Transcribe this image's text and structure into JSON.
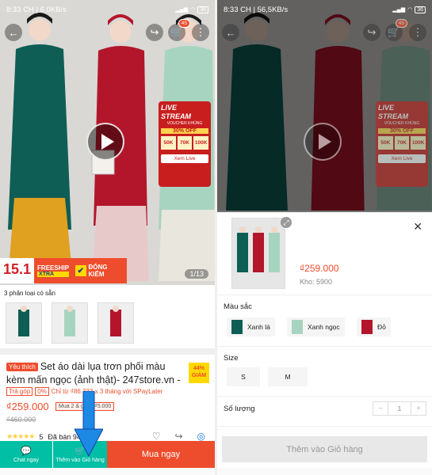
{
  "left": {
    "status": {
      "time": "8:33 CH | 6,0KB/s",
      "battery": "36"
    },
    "cart_badge": "45",
    "live": {
      "title": "LIVE STREAM",
      "subtitle": "VOUCHER KHỦNG",
      "off": "30% OFF",
      "vouchers": [
        "50K",
        "70K",
        "100K"
      ],
      "cta": "Xem Live"
    },
    "banner": {
      "date": "15.1",
      "freeship": "FREESHIP",
      "xtra": "XTRA",
      "dk": "ĐÓNG KIỂM"
    },
    "image_counter": "1/13",
    "variants_label": "3 phân loại có sẵn",
    "product": {
      "tag": "Yêu thích",
      "title": "Set áo dài lụa trơn phối màu kèm mấn ngọc (ảnh thật)- 247store.vn -",
      "discount": "44%",
      "discount_label": "GIẢM",
      "installment_label": "Trả góp",
      "installment_rate": "0%",
      "installment_text": "Chỉ từ ₫86.333 x 3 tháng với SPayLater",
      "price": "₫259.000",
      "buy2_text": "Mua 2 & giảm ₫5.000",
      "old_price": "₫460.000",
      "stars": "★★★★★",
      "rating": "5",
      "sold": "Đã bán 94"
    },
    "actions": {
      "chat": "Chat ngay",
      "add_cart": "Thêm vào Giỏ hàng",
      "buy_now": "Mua ngay"
    }
  },
  "right": {
    "status": {
      "time": "8:33 CH | 56,5KB/s",
      "battery": "36"
    },
    "cart_badge": "45",
    "live": {
      "title": "LIVE STREAM",
      "subtitle": "VOUCHER KHỦNG",
      "off": "30% OFF",
      "vouchers": [
        "50K",
        "70K",
        "100K"
      ],
      "cta": "Xem Live"
    },
    "sheet": {
      "price": "₫259.000",
      "stock": "Kho: 5900",
      "color_label": "Màu sắc",
      "colors": [
        "Xanh lá",
        "Xanh ngọc",
        "Đỏ"
      ],
      "size_label": "Size",
      "sizes": [
        "S",
        "M"
      ],
      "qty_label": "Số lượng",
      "qty_value": "1",
      "add_button": "Thêm vào Giỏ hàng"
    }
  },
  "colors": {
    "accent": "#ee4d2d",
    "teal": "#00bfa5",
    "dress_green": "#0f5e55",
    "dress_red": "#b3162b",
    "dress_mint": "#a7d4c0"
  }
}
